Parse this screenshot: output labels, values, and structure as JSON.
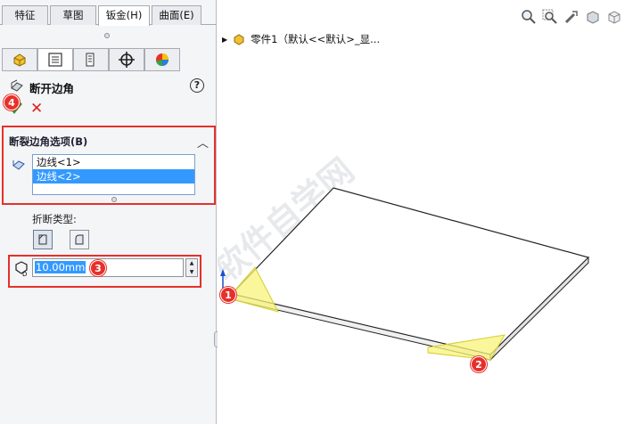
{
  "tabs": [
    {
      "label": "特征",
      "active": false
    },
    {
      "label": "草图",
      "active": false
    },
    {
      "label": "钣金(H)",
      "active": true
    },
    {
      "label": "曲面(E)",
      "active": false
    }
  ],
  "panel_icons": [
    "feature-manager-icon",
    "property-manager-icon",
    "configuration-manager-icon",
    "dim-xpert-icon",
    "display-manager-icon"
  ],
  "feature": {
    "title": "断开边角",
    "help": "?"
  },
  "group": {
    "header": "断裂边角选项(B)",
    "edges": [
      "边线<1>",
      "边线<2>"
    ],
    "selected_index": 1
  },
  "break_type_label": "折断类型:",
  "distance": {
    "value": "10.00mm"
  },
  "badges": {
    "ok": "4",
    "distance": "3",
    "corner1": "1",
    "corner2": "2"
  },
  "tree": {
    "part_label": "零件1（默认<<默认>_显..."
  },
  "watermark": "软件自学网 WWW.RJZXW.COM",
  "colors": {
    "badge": "#e7302a",
    "highlight_box": "#e5312a",
    "selection": "#3399ff",
    "corner_fill": "#f7f37a"
  }
}
